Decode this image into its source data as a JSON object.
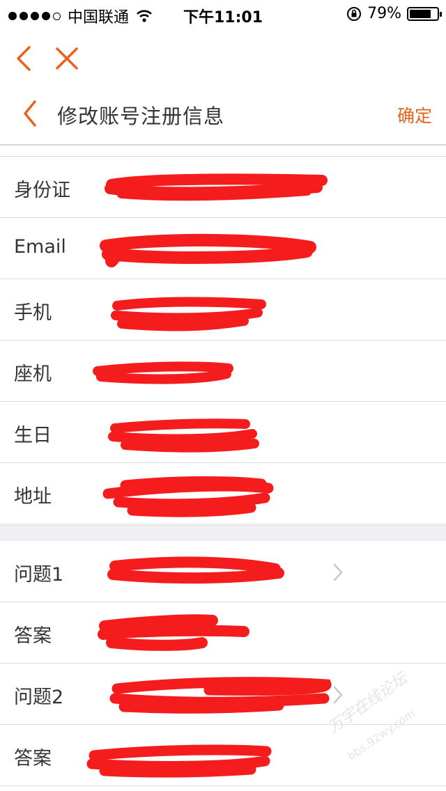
{
  "status_bar": {
    "carrier": "中国联通",
    "time": "下午11:01",
    "battery_percent": "79%",
    "battery_level": 0.79,
    "signal_bars_filled": 4,
    "signal_bars_total": 5
  },
  "top_nav": {
    "back_icon": "chevron-left-icon",
    "close_icon": "close-icon"
  },
  "header": {
    "title": "修改账号注册信息",
    "confirm_label": "确定"
  },
  "colors": {
    "accent": "#e8621c",
    "redaction": "#f41c1c",
    "separator": "#dcdcdc",
    "section_gap": "#efeff4"
  },
  "profile_fields": [
    {
      "label": "身份证"
    },
    {
      "label": "Email"
    },
    {
      "label": "手机"
    },
    {
      "label": "座机"
    },
    {
      "label": "生日"
    },
    {
      "label": "地址"
    }
  ],
  "security_fields": [
    {
      "label": "问题1"
    },
    {
      "label": "答案"
    },
    {
      "label": "问题2"
    },
    {
      "label": "答案"
    }
  ],
  "watermark": {
    "line1": "万宇在线论坛",
    "line2": "bbs.92wy.com"
  }
}
